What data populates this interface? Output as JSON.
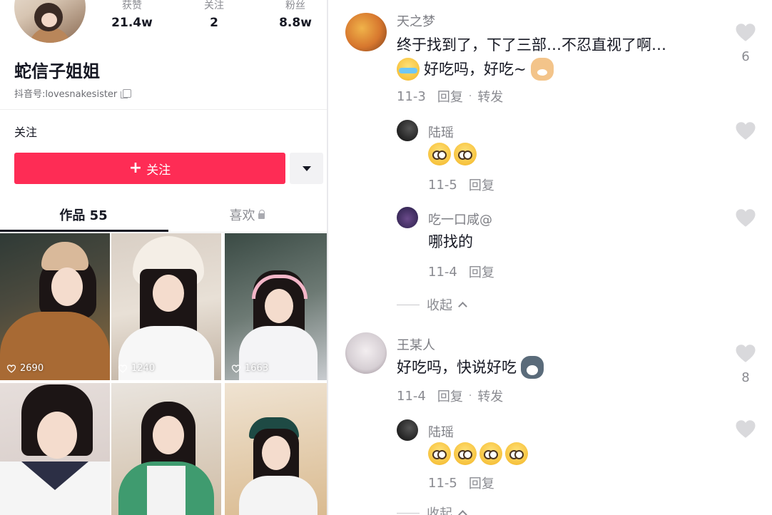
{
  "profile": {
    "stats": [
      {
        "label": "获赞",
        "value": "21.4w"
      },
      {
        "label": "关注",
        "value": "2"
      },
      {
        "label": "粉丝",
        "value": "8.8w"
      }
    ],
    "nickname": "蛇信子姐姐",
    "douyin_id": "抖音号:lovesnakesister",
    "follow_hint": "关注",
    "follow_button": "关注",
    "tabs": {
      "works": "作品 55",
      "likes": "喜欢"
    },
    "videos": [
      {
        "likes": "2690"
      },
      {
        "likes": "1240"
      },
      {
        "likes": "1663"
      },
      {
        "likes": ""
      },
      {
        "likes": ""
      },
      {
        "likes": ""
      }
    ]
  },
  "comments": [
    {
      "name": "天之梦",
      "text_line1": "终于找到了，下了三部…不忍直视了啊…",
      "text_line2": "好吃吗，好吃~",
      "date": "11-3",
      "reply": "回复",
      "forward": "转发",
      "like_count": "6",
      "replies": [
        {
          "name": "陆瑶",
          "emojis": 2,
          "date": "11-5",
          "reply": "回复"
        },
        {
          "name": "吃一口咸@",
          "text": "哪找的",
          "date": "11-4",
          "reply": "回复"
        }
      ],
      "collapse": "收起"
    },
    {
      "name": "王某人",
      "text": "好吃吗，快说好吃",
      "date": "11-4",
      "reply": "回复",
      "forward": "转发",
      "like_count": "8",
      "replies": [
        {
          "name": "陆瑶",
          "emojis": 4,
          "date": "11-5",
          "reply": "回复"
        }
      ],
      "collapse": "收起"
    }
  ],
  "colors": {
    "accent": "#fe2c55",
    "muted": "#8a8b91",
    "text": "#161823"
  },
  "icons": [
    "copy-icon",
    "plus-icon",
    "chevron-down-icon",
    "lock-icon",
    "heart-icon",
    "chevron-up-icon"
  ]
}
